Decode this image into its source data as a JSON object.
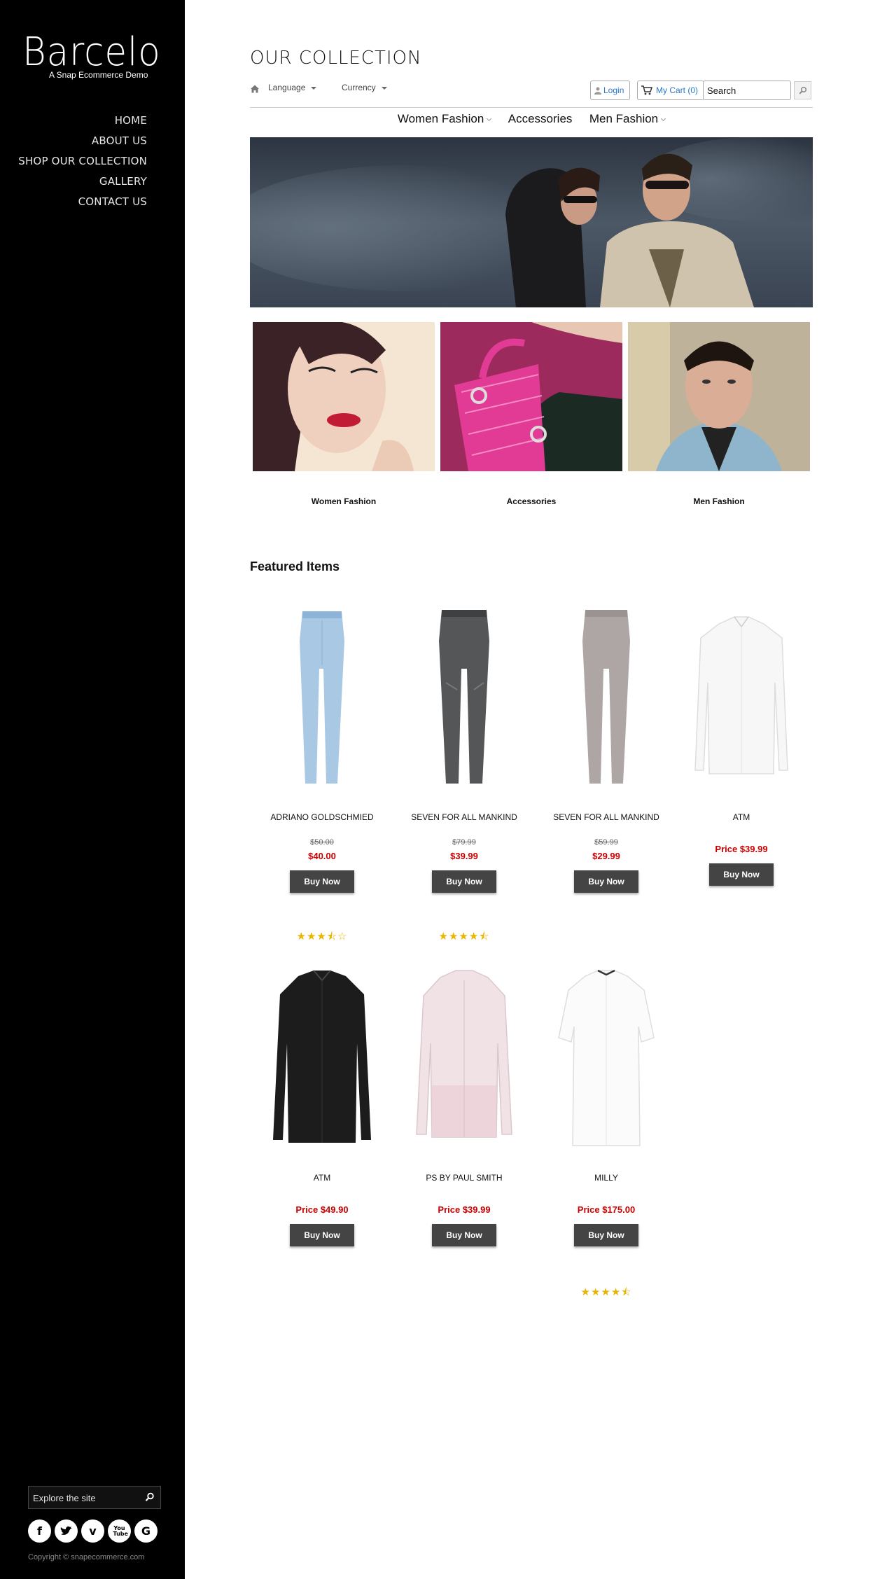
{
  "sidebar": {
    "logo": "Barcelo",
    "tagline": "A Snap Ecommerce Demo",
    "nav": [
      "HOME",
      "ABOUT US",
      "SHOP OUR COLLECTION",
      "GALLERY",
      "CONTACT US"
    ],
    "explore_placeholder": "Explore the site",
    "socials": [
      "facebook-icon",
      "twitter-icon",
      "vimeo-icon",
      "youtube-icon",
      "google-plus-icon"
    ],
    "youtube_text": "You Tube",
    "copyright": "Copyright © snapecommerce.com"
  },
  "header": {
    "title": "OUR COLLECTION",
    "language_label": "Language",
    "currency_label": "Currency",
    "login_label": "Login",
    "cart_label": "My Cart (0)",
    "search_placeholder": "Search"
  },
  "category_nav": [
    "Women Fashion",
    "Accessories",
    "Men Fashion"
  ],
  "categories": [
    {
      "label": "Women Fashion"
    },
    {
      "label": "Accessories"
    },
    {
      "label": "Men Fashion"
    }
  ],
  "featured": {
    "title": "Featured Items",
    "buy_label": "Buy Now",
    "products": [
      {
        "name": "ADRIANO GOLDSCHMIED",
        "old_price": "$50.00",
        "price": "$40.00",
        "stars": "★★★⯪☆",
        "image": "jeans-light-blue"
      },
      {
        "name": "SEVEN FOR ALL MANKIND",
        "old_price": "$79.99",
        "price": "$39.99",
        "stars": "★★★★⯪",
        "image": "jeans-grey"
      },
      {
        "name": "SEVEN FOR ALL MANKIND",
        "old_price": "$59.99",
        "price": "$29.99",
        "stars": "",
        "image": "jeans-taupe"
      },
      {
        "name": "ATM",
        "old_price": "",
        "price": "Price $39.99",
        "stars": "",
        "image": "shirt-white"
      },
      {
        "name": "ATM",
        "old_price": "",
        "price": "Price $49.90",
        "stars": "",
        "image": "shirt-black"
      },
      {
        "name": "PS BY PAUL SMITH",
        "old_price": "",
        "price": "Price $39.99",
        "stars": "",
        "image": "shirt-pink"
      },
      {
        "name": "MILLY",
        "old_price": "",
        "price": "Price $175.00",
        "stars": "★★★★⯪",
        "image": "blouse-white"
      }
    ]
  },
  "colors": {
    "sidebar": "#000000",
    "price": "#cc0000",
    "button": "#444444",
    "stars": "#e8b400",
    "link": "#2a77c9"
  }
}
